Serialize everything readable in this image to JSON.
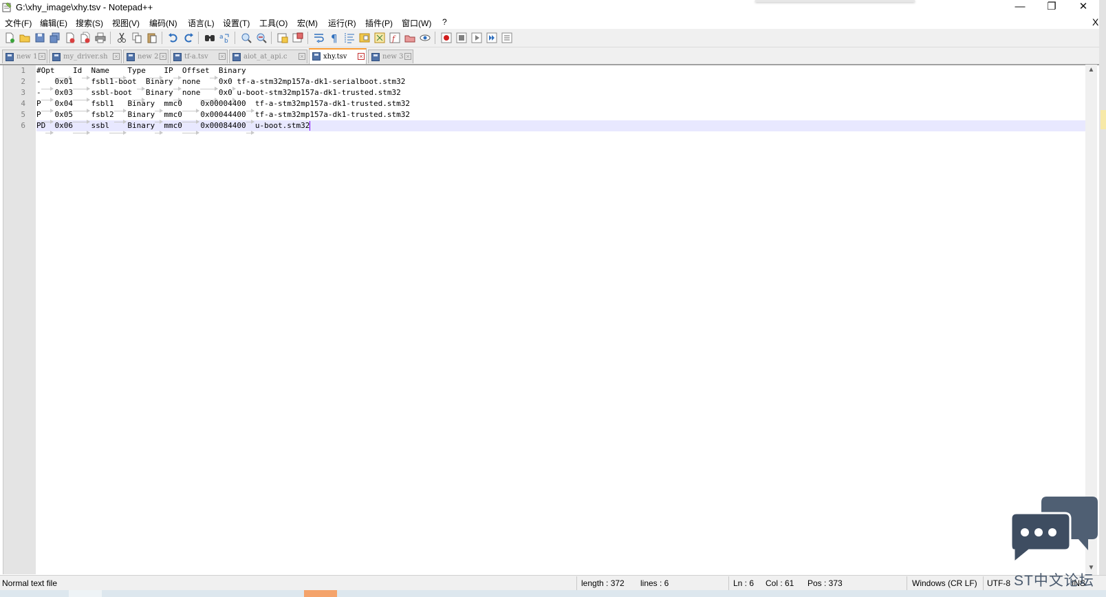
{
  "window": {
    "title": "G:\\xhy_image\\xhy.tsv - Notepad++",
    "minimize": "—",
    "restore": "❐",
    "close": "✕"
  },
  "menu": {
    "items": [
      "文件(F)",
      "编辑(E)",
      "搜索(S)",
      "视图(V)",
      "编码(N)",
      "语言(L)",
      "设置(T)",
      "工具(O)",
      "宏(M)",
      "运行(R)",
      "插件(P)",
      "窗口(W)",
      "?"
    ],
    "close_doc": "X"
  },
  "toolbar": {
    "icons": [
      "new-file-icon",
      "open-file-icon",
      "save-icon",
      "save-all-icon",
      "close-icon",
      "close-all-icon",
      "print-icon",
      "cut-icon",
      "copy-icon",
      "paste-icon",
      "undo-icon",
      "redo-icon",
      "find-icon",
      "replace-icon",
      "zoom-in-icon",
      "zoom-out-icon",
      "sync-vertical-icon",
      "sync-horizontal-icon",
      "word-wrap-icon",
      "show-all-chars-icon",
      "indent-guide-icon",
      "doc-map-icon",
      "function-list-icon",
      "folder-workspace-icon",
      "doc-list-icon",
      "monitor-icon",
      "record-macro-icon",
      "stop-record-icon",
      "play-macro-icon",
      "run-macro-multiple-icon",
      "save-macro-icon"
    ]
  },
  "tabs": [
    {
      "label": "new 1",
      "active": false
    },
    {
      "label": "my_driver.sh",
      "active": false
    },
    {
      "label": "new 2",
      "active": false
    },
    {
      "label": "tf-a.tsv",
      "active": false
    },
    {
      "label": "aiot_at_api.c",
      "active": false
    },
    {
      "label": "xhy.tsv",
      "active": true
    },
    {
      "label": "new 3",
      "active": false
    }
  ],
  "editor": {
    "lines": [
      [
        "#Opt",
        "Id",
        "Name",
        "Type",
        "IP",
        "Offset",
        "Binary"
      ],
      [
        "-",
        "0x01",
        "fsbl1-boot",
        "Binary",
        "none",
        "0x0",
        "tf-a-stm32mp157a-dk1-serialboot.stm32"
      ],
      [
        "-",
        "0x03",
        "ssbl-boot",
        "Binary",
        "none",
        "0x0",
        "u-boot-stm32mp157a-dk1-trusted.stm32"
      ],
      [
        "P",
        "0x04",
        "fsbl1",
        "Binary",
        "mmc0",
        "0x00004400",
        "tf-a-stm32mp157a-dk1-trusted.stm32"
      ],
      [
        "P",
        "0x05",
        "fsbl2",
        "Binary",
        "mmc0",
        "0x00044400",
        "tf-a-stm32mp157a-dk1-trusted.stm32"
      ],
      [
        "PD",
        "0x06",
        "ssbl",
        "Binary",
        "mmc0",
        "0x00084400",
        "u-boot.stm32"
      ]
    ],
    "current_line": 6
  },
  "status": {
    "file_type": "Normal text file",
    "length": "length : 372",
    "lines": "lines : 6",
    "ln": "Ln : 6",
    "col": "Col : 61",
    "pos": "Pos : 373",
    "eol": "Windows (CR LF)",
    "encoding": "UTF-8",
    "mode": "INS"
  },
  "watermark": {
    "text": "ST中文论坛"
  },
  "colors": {
    "accent_tab": "#fa9b32",
    "current_line": "#e8e8ff",
    "caret": "#8000ff"
  }
}
